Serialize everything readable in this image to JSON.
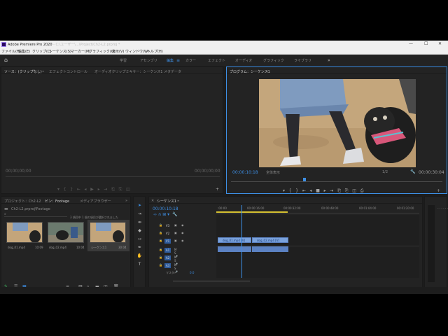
{
  "window": {
    "app_title": "Adobe Premiere Pro 2020",
    "project_path": "- C:\\ユーザー\\...\\Project\\Ch2-L2.prproj *",
    "minimize": "—",
    "maximize": "☐",
    "close": "✕"
  },
  "menu": [
    "ファイル(F)",
    "編集(E)",
    "クリップ(C)",
    "シーケンス(S)",
    "マーカー(M)",
    "グラフィック(G)",
    "表示(V)",
    "ウィンドウ(W)",
    "ヘルプ(H)"
  ],
  "workspaces": [
    "学習",
    "アセンブリ",
    "編集",
    "カラー",
    "エフェクト",
    "オーディオ",
    "グラフィック",
    "ライブラリ",
    "»"
  ],
  "active_workspace": "編集",
  "source_panel": {
    "tabs": [
      "ソース：(クリップなし)",
      "エフェクトコントロール",
      "オーディオクリップミキサー：シーケンス1",
      "メタデータ"
    ],
    "timecode_left": "00;00;00;00",
    "timecode_right": "00;00;00;00"
  },
  "program_panel": {
    "tab": "プログラム：シーケンス1",
    "timecode": "00:00:10:18",
    "fit_label": "全体表示",
    "scale": "1/2",
    "duration": "00:00:30:04"
  },
  "project_panel": {
    "tabs": [
      "プロジェクト：Ch2-L2",
      "ビン：Footage",
      "メディアブラウザー"
    ],
    "path": "Ch2-L2.prproj\\Footage",
    "selection_status": "3 項目中 1 個の項目が選択されました",
    "clips": [
      {
        "name": "dog_01.mp4",
        "duration": "10:09"
      },
      {
        "name": "dog_02.mp4",
        "duration": "10:04"
      },
      {
        "name": "シーケンス1",
        "duration": "30:04"
      }
    ]
  },
  "timeline": {
    "tab": "シーケンス1",
    "timecode": "00:00:10:18",
    "ruler": [
      ":00:00",
      "00:00:16:00",
      "00:00:32:00",
      "00:00:48:00",
      "00:01:04:00",
      "00:01:20:00"
    ],
    "video_tracks": [
      "V3",
      "V2",
      "V1"
    ],
    "audio_tracks": [
      "A1",
      "A2",
      "A3"
    ],
    "master_label": "マスター",
    "master_value": "0.0",
    "clips": [
      {
        "name": "dog_01.mp4 [V]",
        "track": "V1"
      },
      {
        "name": "dog_02.mp4 [V]",
        "track": "V1"
      }
    ]
  },
  "colors": {
    "accent": "#3d8fe5",
    "panel": "#232323",
    "background": "#1d1d1d",
    "clip_video": "#7aa2dc",
    "clip_audio": "#5c82c3"
  }
}
